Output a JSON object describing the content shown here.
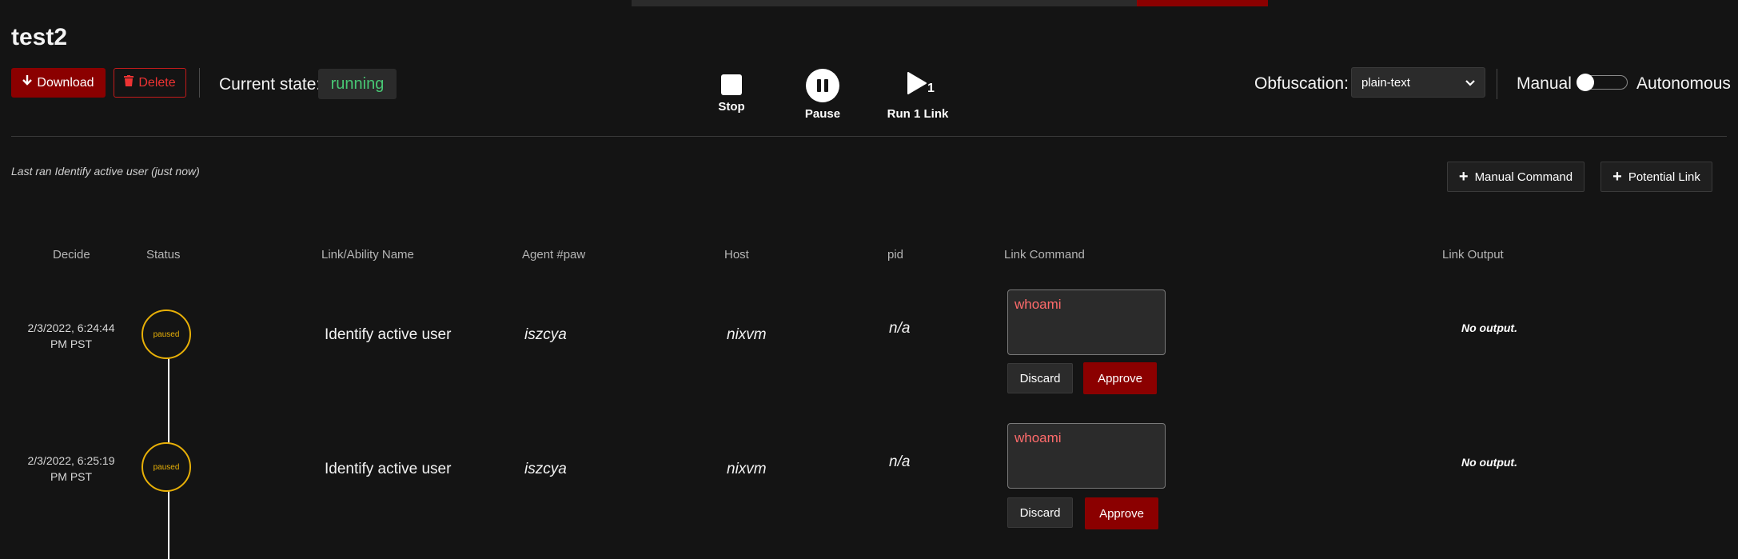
{
  "operation": {
    "title": "test2",
    "download_label": "Download",
    "delete_label": "Delete",
    "state_label": "Current state:",
    "state_value": "running"
  },
  "controls": {
    "stop_label": "Stop",
    "pause_label": "Pause",
    "run_label": "Run 1 Link",
    "run_count": "1"
  },
  "settings": {
    "obfuscation_label": "Obfuscation:",
    "obfuscation_value": "plain-text",
    "manual_label": "Manual",
    "autonomous_label": "Autonomous",
    "autonomous_enabled": false
  },
  "status_line": "Last ran Identify active user (just now)",
  "actions": {
    "manual_command_label": "Manual Command",
    "potential_link_label": "Potential Link"
  },
  "table": {
    "headers": [
      "Decide",
      "Status",
      "Link/Ability Name",
      "Agent #paw",
      "Host",
      "pid",
      "Link Command",
      "Link Output"
    ],
    "rows": [
      {
        "date_line1": "2/3/2022, 6:24:44",
        "date_line2": "PM PST",
        "status": "paused",
        "ability": "Identify active user",
        "paw": "iszcya",
        "host": "nixvm",
        "pid": "n/a",
        "command": "whoami",
        "discard_label": "Discard",
        "approve_label": "Approve",
        "output": "No output."
      },
      {
        "date_line1": "2/3/2022, 6:25:19",
        "date_line2": "PM PST",
        "status": "paused",
        "ability": "Identify active user",
        "paw": "iszcya",
        "host": "nixvm",
        "pid": "n/a",
        "command": "whoami",
        "discard_label": "Discard",
        "approve_label": "Approve",
        "output": "No output."
      }
    ]
  },
  "colors": {
    "accent_red": "#8b0000",
    "running_green": "#48c774",
    "paused_yellow": "#e8b007",
    "command_text": "#ff6b6b"
  }
}
